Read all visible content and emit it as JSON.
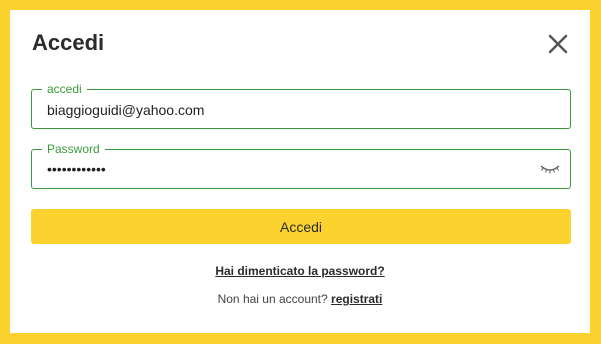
{
  "dialog": {
    "title": "Accedi"
  },
  "email_field": {
    "label": "accedi",
    "value": "biaggioguidi@yahoo.com"
  },
  "password_field": {
    "label": "Password",
    "masked_value": "••••••••••••"
  },
  "submit_label": "Accedi",
  "forgot_password_label": "Hai dimenticato la password?",
  "register": {
    "prompt": "Non hai un account?",
    "link_label": "registrati"
  },
  "colors": {
    "frame": "#fcd32e",
    "accent_green": "#3a9b3a",
    "button": "#fcd32e"
  },
  "icons": {
    "close": "close-icon",
    "toggle_password": "eye-closed-icon"
  }
}
